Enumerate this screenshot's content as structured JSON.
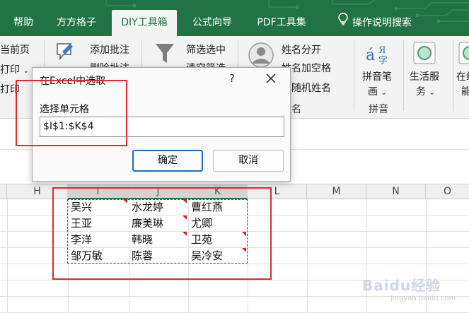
{
  "tabs": [
    {
      "label": "帮助",
      "active": false
    },
    {
      "label": "方方格子",
      "active": false
    },
    {
      "label": "DIY工具箱",
      "active": true
    },
    {
      "label": "公式向导",
      "active": false
    },
    {
      "label": "PDF工具集",
      "active": false
    },
    {
      "label": "操作说明搜索",
      "active": false,
      "icon": "lightbulb-icon"
    }
  ],
  "ribbon": {
    "page_items": [
      "当前页",
      "打印",
      "打印"
    ],
    "comment": {
      "add": "添加批注",
      "delete": "删除批注"
    },
    "filter": {
      "filter_select": "筛选选中",
      "clear_filter": "清空筛选"
    },
    "names": {
      "split": "姓名分开",
      "add_space": "姓名加空格",
      "random": "生成随机姓名",
      "group": "姓名"
    },
    "pinyin": {
      "button_line1": "拼音笔",
      "button_line2": "画",
      "group": "拼音"
    },
    "life": {
      "button_line1": "生活服",
      "button_line2": "务"
    },
    "partial": {
      "line1": "在线",
      "line2": "能"
    }
  },
  "dialog": {
    "title": "在Excel中选取",
    "help": "?",
    "label": "选择单元格",
    "value": "$I$1:$K$4",
    "ok": "确定",
    "cancel": "取消"
  },
  "columns": [
    "H",
    "I",
    "J",
    "K",
    "L",
    "M",
    "N",
    "O"
  ],
  "cells": {
    "I": [
      "吴兴",
      "王亚",
      "李洋",
      "邹万敏"
    ],
    "J": [
      "水龙婷",
      "廉美琳",
      "韩晓",
      "陈蓉"
    ],
    "K": [
      "曹红燕",
      "尤卿",
      "卫苑",
      "吴冷安"
    ]
  },
  "watermark": {
    "brand": "Baidu经验",
    "sub": "jingyan.baidu.com"
  },
  "colors": {
    "excel_green": "#217346",
    "annotation_red": "#e02b2b"
  }
}
